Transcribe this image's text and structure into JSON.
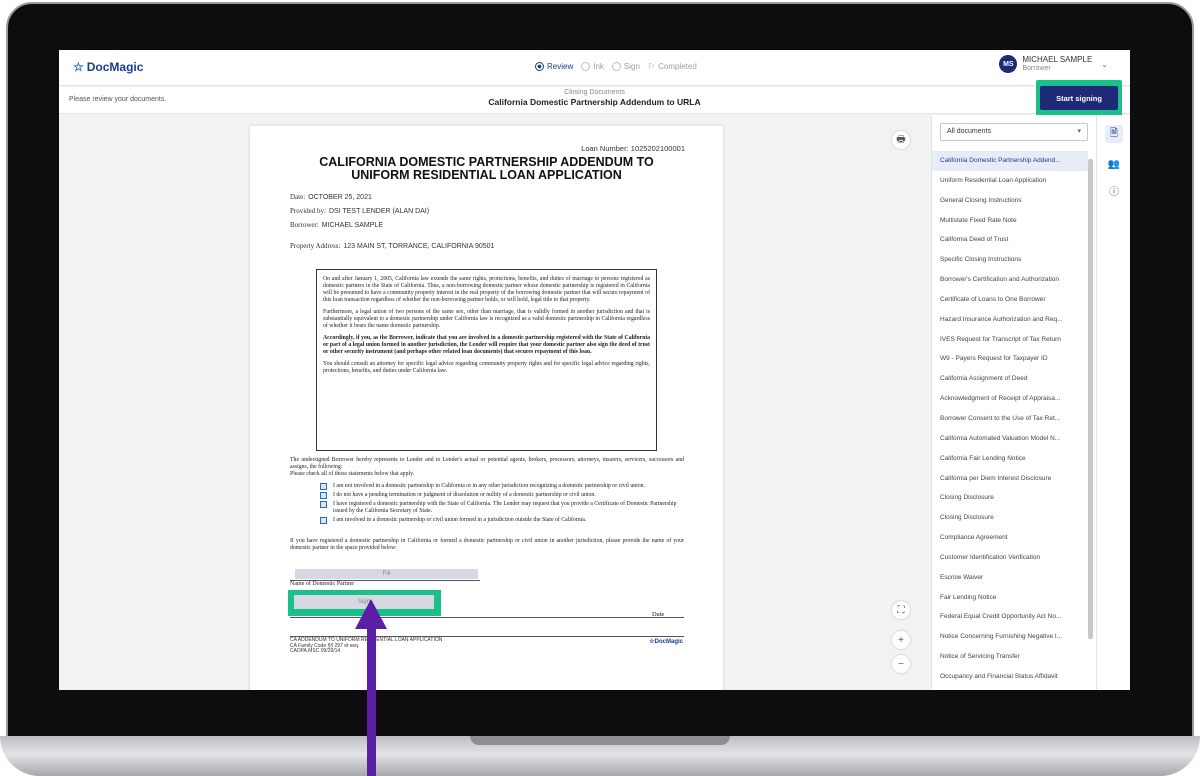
{
  "app": {
    "logo": "DocMagic",
    "steps": [
      {
        "label": "Review"
      },
      {
        "label": "Ink"
      },
      {
        "label": "Sign"
      },
      {
        "label": "Completed"
      }
    ],
    "user": {
      "initials": "MS",
      "name": "MICHAEL SAMPLE",
      "role": "Borrower"
    }
  },
  "subheader": {
    "message": "Please review your documents.",
    "category": "Closing Documents",
    "title": "California Domestic Partnership Addendum to URLA",
    "start_signing": "Start signing"
  },
  "document": {
    "loan_number": "Loan Number: 1025202100001",
    "title_line1": "CALIFORNIA DOMESTIC PARTNERSHIP ADDENDUM TO",
    "title_line2": "UNIFORM RESIDENTIAL LOAN APPLICATION",
    "date_label": "Date:",
    "date_value": "OCTOBER 25, 2021",
    "provided_label": "Provided by:",
    "provided_value": "DSI TEST LENDER (ALAN DAI)",
    "borrower_label": "Borrower:",
    "borrower_value": "MICHAEL SAMPLE",
    "property_label": "Property Address:",
    "property_value": "123 MAIN ST, TORRANCE, CALIFORNIA 90501",
    "notice_p1": "On and after January 1, 2005, California law extends the same rights, protections, benefits, and duties of marriage to persons registered as domestic partners in the State of California. Thus, a non-borrowing domestic partner whose domestic partnership is registered in California will be presumed to have a community property interest in the real property of the borrowing domestic partner that will secure repayment of this loan transaction regardless of whether the non-borrowing partner holds, or will hold, legal title to that property.",
    "notice_p2": "Furthermore, a legal union of two persons of the same sex, other than marriage, that is validly formed in another jurisdiction and that is substantially equivalent to a domestic partnership under California law is recognized as a valid domestic partnership in California regardless of whether it bears the name domestic partnership.",
    "notice_p3": "Accordingly, if you, as the Borrower, indicate that you are involved in a domestic partnership registered with the State of California or part of a legal union formed in another jurisdiction, the Lender will require that your domestic partner also sign the deed of trust or other security instrument (and perhaps other related loan documents) that secures repayment of this loan.",
    "notice_p4": "You should consult an attorney for specific legal advice regarding community property rights and for specific legal advice regarding rights, protections, benefits, and duties under California law.",
    "undersigned": "The undersigned Borrower hereby represents to Lender and to Lender's actual or potential agents, brokers, processors, attorneys, insurers, servicers, successors and assigns, the following:",
    "check_intro": "Please check all of those statements below that apply.",
    "checks": [
      "I am not involved in a domestic partnership in California or in any other jurisdiction recognizing a domestic partnership or civil union.",
      "I do not have a pending termination or judgment of dissolution or nullity of a domestic partnership or civil union.",
      "I have registered a domestic partnership with the State of California. The Lender may request that you provide a Certificate of Domestic Partnership issued by the California Secretary of State.",
      "I am involved in a domestic partnership or civil union formed in a jurisdiction outside the State of California."
    ],
    "partner_note": "If you have registered a domestic partnership in California or formed a domestic partnership or civil union in another jurisdiction, please provide the name of your domestic partner in the space provided below:",
    "fill_label": "Fill",
    "partner_label": "Name of Domestic Partner",
    "sign_label": "Sign",
    "date_field_label": "Date",
    "footer_line1": "CA ADDENDUM TO UNIFORM RESIDENTIAL LOAN APPLICATION",
    "footer_line2": "CA Family Code §§ 297 et seq.",
    "footer_line3": "CADPA.MSC  09/29/14",
    "footer_logo": "DocMagic"
  },
  "doc_list": {
    "filter": "All documents",
    "items": [
      "California Domestic Partnership Addend...",
      "Uniform Residential Loan Application",
      "General Closing Instructions",
      "Multistate Fixed Rate Note",
      "California Deed of Trust",
      "Specific Closing Instructions",
      "Borrower's Certification and Authorization",
      "Certificate of Loans to One Borrower",
      "Hazard Insurance Authorization and Req...",
      "IVES Request for Transcript of Tax Return",
      "W9 - Payers Request for Taxpayer ID",
      "California Assignment of Deed",
      "Acknowledgment of Receipt of Appraisa...",
      "Borrower Consent to the Use of Tax Ret...",
      "California Automated Valuation Model N...",
      "California Fair Lending Notice",
      "California per Diem Interest Disclosure",
      "Closing Disclosure",
      "Closing Disclosure",
      "Compliance Agreement",
      "Customer Identification Verification",
      "Escrow Waiver",
      "Fair Lending Notice",
      "Federal Equal Credit Opportunity Act No...",
      "Notice Concerning Furnishing Negative I...",
      "Notice of Servicing Transfer",
      "Occupancy and Financial Status Affidavit"
    ]
  },
  "icons": {
    "print": "print-icon",
    "fullscreen": "fullscreen-icon",
    "zoom_in": "zoom-in-icon",
    "zoom_out": "zoom-out-icon",
    "documents": "document-icon",
    "signers": "users-icon",
    "info": "info-icon"
  },
  "colors": {
    "brand": "#1e2a78",
    "highlight": "#1bbf8a",
    "arrow": "#5b1fa5"
  }
}
